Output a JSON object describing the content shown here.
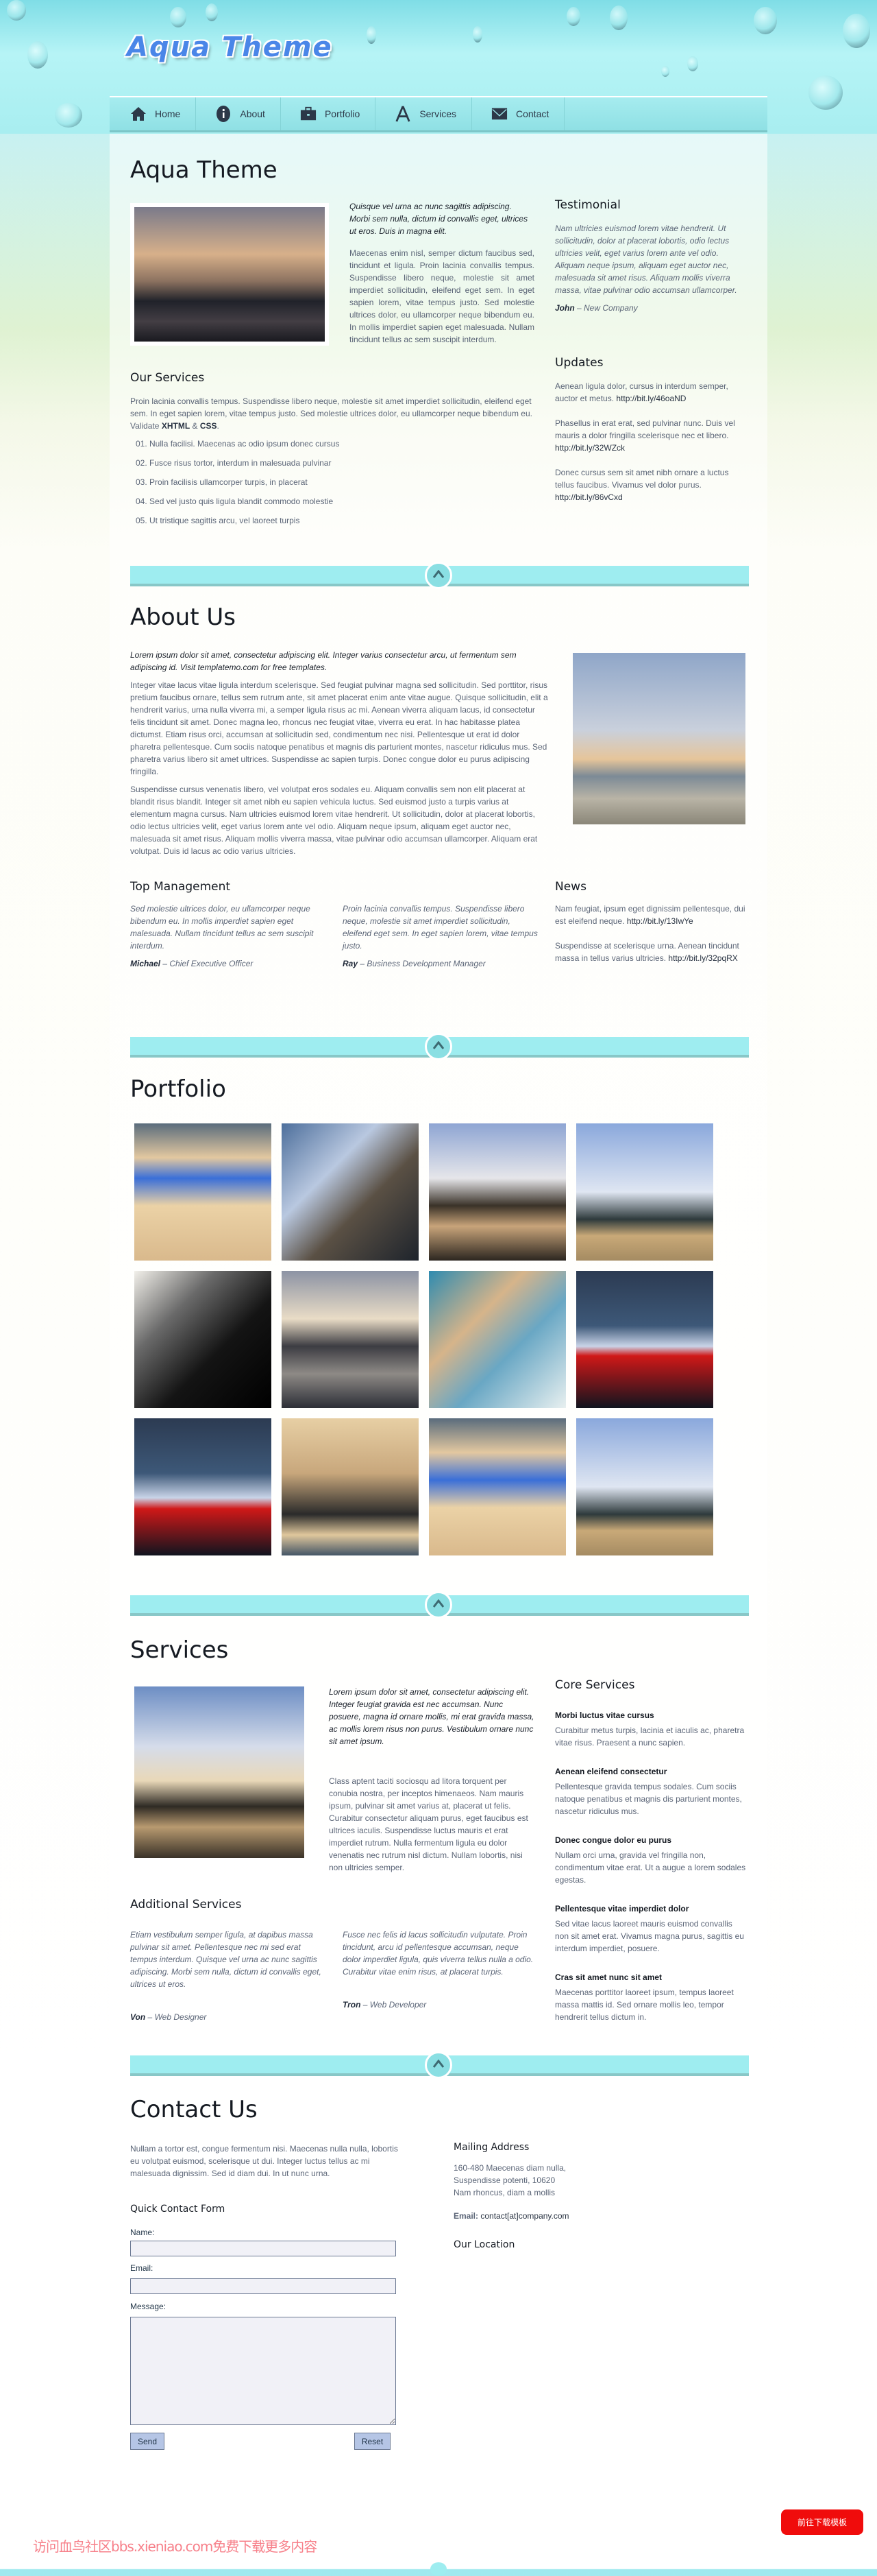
{
  "site": {
    "logo_text": "Aqua Theme"
  },
  "nav": [
    {
      "label": "Home",
      "icon": "home-icon"
    },
    {
      "label": "About",
      "icon": "info-icon"
    },
    {
      "label": "Portfolio",
      "icon": "briefcase-icon"
    },
    {
      "label": "Services",
      "icon": "tools-icon"
    },
    {
      "label": "Contact",
      "icon": "envelope-icon"
    }
  ],
  "home": {
    "title": "Aqua Theme",
    "intro_lead": "Quisque vel urna ac nunc sagittis adipiscing. Morbi sem nulla, dictum id convallis eget, ultrices ut eros. Duis in magna elit.",
    "intro_text": "Maecenas enim nisl, semper dictum faucibus sed, tincidunt et ligula. Proin lacinia convallis tempus. Suspendisse libero neque, molestie sit amet imperdiet sollicitudin, eleifend eget sem. In eget sapien lorem, vitae tempus justo. Sed molestie ultrices dolor, eu ullamcorper neque bibendum eu. In mollis imperdiet sapien eget malesuada. Nullam tincidunt tellus ac sem suscipit interdum.",
    "services_title": "Our Services",
    "services_text": "Proin lacinia convallis tempus. Suspendisse libero neque, molestie sit amet imperdiet sollicitudin, eleifend eget sem. In eget sapien lorem, vitae tempus justo. Sed molestie ultrices dolor, eu ullamcorper neque bibendum eu. Validate",
    "validate_xhtml": "XHTML",
    "validate_amp": "&",
    "validate_css": "CSS",
    "services_list": [
      "01. Nulla facilisi. Maecenas ac odio ipsum donec cursus",
      "02. Fusce risus tortor, interdum in malesuada pulvinar",
      "03. Proin facilisis ullamcorper turpis, in placerat",
      "04. Sed vel justo quis ligula blandit commodo molestie",
      "05. Ut tristique sagittis arcu, vel laoreet turpis"
    ],
    "testimonial_title": "Testimonial",
    "testimonial_text": "Nam ultricies euismod lorem vitae hendrerit. Ut sollicitudin, dolor at placerat lobortis, odio lectus ultricies velit, eget varius lorem ante vel odio. Aliquam neque ipsum, aliquam eget auctor nec, malesuada sit amet risus. Aliquam mollis viverra massa, vitae pulvinar odio accumsan ullamcorper.",
    "testimonial_name": "John",
    "testimonial_role": "New Company",
    "updates_title": "Updates",
    "updates": [
      {
        "text": "Aenean ligula dolor, cursus in interdum semper, auctor et metus.",
        "link": "http://bit.ly/46oaND"
      },
      {
        "text": "Phasellus in erat erat, sed pulvinar nunc. Duis vel mauris a dolor fringilla scelerisque nec et libero.",
        "link": "http://bit.ly/32WZck"
      },
      {
        "text": "Donec cursus sem sit amet nibh ornare a luctus tellus faucibus. Vivamus vel dolor purus.",
        "link": "http://bit.ly/86vCxd"
      }
    ]
  },
  "about": {
    "title": "About Us",
    "lead": "Lorem ipsum dolor sit amet, consectetur adipiscing elit. Integer varius consectetur arcu, ut fermentum sem adipiscing id. Visit templatemo.com for free templates.",
    "para1": "Integer vitae lacus vitae ligula interdum scelerisque. Sed feugiat pulvinar magna sed sollicitudin. Sed porttitor, risus pretium faucibus ornare, tellus sem rutrum ante, sit amet placerat enim ante vitae augue. Quisque sollicitudin, elit a hendrerit varius, urna nulla viverra mi, a semper ligula risus ac mi. Aenean viverra aliquam lacus, id consectetur felis tincidunt sit amet. Donec magna leo, rhoncus nec feugiat vitae, viverra eu erat. In hac habitasse platea dictumst. Etiam risus orci, accumsan at sollicitudin sed, condimentum nec nisi. Pellentesque ut erat id dolor pharetra pellentesque. Cum sociis natoque penatibus et magnis dis parturient montes, nascetur ridiculus mus. Sed pharetra varius libero sit amet ultrices. Suspendisse ac sapien turpis. Donec congue dolor eu purus adipiscing fringilla.",
    "para2": "Suspendisse cursus venenatis libero, vel volutpat eros sodales eu. Aliquam convallis sem non elit placerat at blandit risus blandit. Integer sit amet nibh eu sapien vehicula luctus. Sed euismod justo a turpis varius at elementum magna cursus. Nam ultricies euismod lorem vitae hendrerit. Ut sollicitudin, dolor at placerat lobortis, odio lectus ultricies velit, eget varius lorem ante vel odio. Aliquam neque ipsum, aliquam eget auctor nec, malesuada sit amet risus. Aliquam mollis viverra massa, vitae pulvinar odio accumsan ullamcorper. Aliquam erat volutpat. Duis id lacus ac odio varius ultricies.",
    "management_title": "Top Management",
    "management": [
      {
        "text": "Sed molestie ultrices dolor, eu ullamcorper neque bibendum eu. In mollis imperdiet sapien eget malesuada. Nullam tincidunt tellus ac sem suscipit interdum.",
        "name": "Michael",
        "role": "Chief Executive Officer"
      },
      {
        "text": "Proin lacinia convallis tempus. Suspendisse libero neque, molestie sit amet imperdiet sollicitudin, eleifend eget sem. In eget sapien lorem, vitae tempus justo.",
        "name": "Ray",
        "role": "Business Development Manager"
      }
    ],
    "news_title": "News",
    "news": [
      {
        "text": "Nam feugiat, ipsum eget dignissim pellentesque, dui est eleifend neque.",
        "link": "http://bit.ly/13IwYe"
      },
      {
        "text": "Suspendisse at scelerisque urna. Aenean tincidunt massa in tellus varius ultricies.",
        "link": "http://bit.ly/32pqRX"
      }
    ]
  },
  "portfolio": {
    "title": "Portfolio"
  },
  "services": {
    "title": "Services",
    "lead": "Lorem ipsum dolor sit amet, consectetur adipiscing elit. Integer feugiat gravida est nec accumsan. Nunc posuere, magna id ornare mollis, mi erat gravida massa, ac mollis lorem risus non purus. Vestibulum ornare nunc sit amet ipsum.",
    "text": "Class aptent taciti sociosqu ad litora torquent per conubia nostra, per inceptos himenaeos. Nam mauris ipsum, pulvinar sit amet varius at, placerat ut felis. Curabitur consectetur aliquam purus, eget faucibus est ultrices iaculis. Suspendisse luctus mauris et erat imperdiet rutrum. Nulla fermentum ligula eu dolor venenatis nec rutrum nisl dictum. Nullam lobortis, nisi non ultricies semper.",
    "additional_title": "Additional Services",
    "additional": [
      {
        "text": "Etiam vestibulum semper ligula, at dapibus massa pulvinar sit amet. Pellentesque nec mi sed erat tempus interdum. Quisque vel urna ac nunc sagittis adipiscing. Morbi sem nulla, dictum id convallis eget, ultrices ut eros.",
        "name": "Von",
        "role": "Web Designer"
      },
      {
        "text": "Fusce nec felis id lacus sollicitudin vulputate. Proin tincidunt, arcu id pellentesque accumsan, neque dolor imperdiet ligula, quis viverra tellus nulla a odio. Curabitur vitae enim risus, at placerat turpis.",
        "name": "Tron",
        "role": "Web Developer"
      }
    ],
    "core_title": "Core Services",
    "core": [
      {
        "title": "Morbi luctus vitae cursus",
        "text": "Curabitur metus turpis, lacinia et iaculis ac, pharetra vitae risus. Praesent a nunc sapien."
      },
      {
        "title": "Aenean eleifend consectetur",
        "text": "Pellentesque gravida tempus sodales. Cum sociis natoque penatibus et magnis dis parturient montes, nascetur ridiculus mus."
      },
      {
        "title": "Donec congue dolor eu purus",
        "text": "Nullam orci urna, gravida vel fringilla non, condimentum vitae erat. Ut a augue a lorem sodales egestas."
      },
      {
        "title": "Pellentesque vitae imperdiet dolor",
        "text": "Sed vitae lacus laoreet mauris euismod convallis non sit amet erat. Vivamus magna purus, sagittis eu interdum imperdiet, posuere."
      },
      {
        "title": "Cras sit amet nunc sit amet",
        "text": "Maecenas porttitor laoreet ipsum, tempus laoreet massa mattis id. Sed ornare mollis leo, tempor hendrerit tellus dictum in."
      }
    ]
  },
  "contact": {
    "title": "Contact Us",
    "text": "Nullam a tortor est, congue fermentum nisi. Maecenas nulla nulla, lobortis eu volutpat euismod, scelerisque ut dui. Integer luctus tellus ac mi malesuada dignissim. Sed id diam dui. In ut nunc urna.",
    "form_title": "Quick Contact Form",
    "name_label": "Name:",
    "name_value": "",
    "email_label": "Email:",
    "email_value": "",
    "message_label": "Message:",
    "message_value": "",
    "send_label": "Send",
    "reset_label": "Reset",
    "mailing_title": "Mailing Address",
    "address_lines": [
      "160-480 Maecenas diam nulla,",
      "Suspendisse potenti, 10620",
      "Nam rhoncus, diam a mollis"
    ],
    "email_key": "Email:",
    "email_address": "contact[at]company.com",
    "location_title": "Our Location"
  },
  "overlay": {
    "download_button": "前往下载模板",
    "watermark": "访问血鸟社区bbs.xieniao.com免费下载更多内容",
    "download_color": "#f00c0c"
  },
  "colors": {
    "accent": "#9eedf0",
    "accent_dark": "#88c7c7",
    "heading": "#151a22",
    "text": "#5b6577"
  }
}
